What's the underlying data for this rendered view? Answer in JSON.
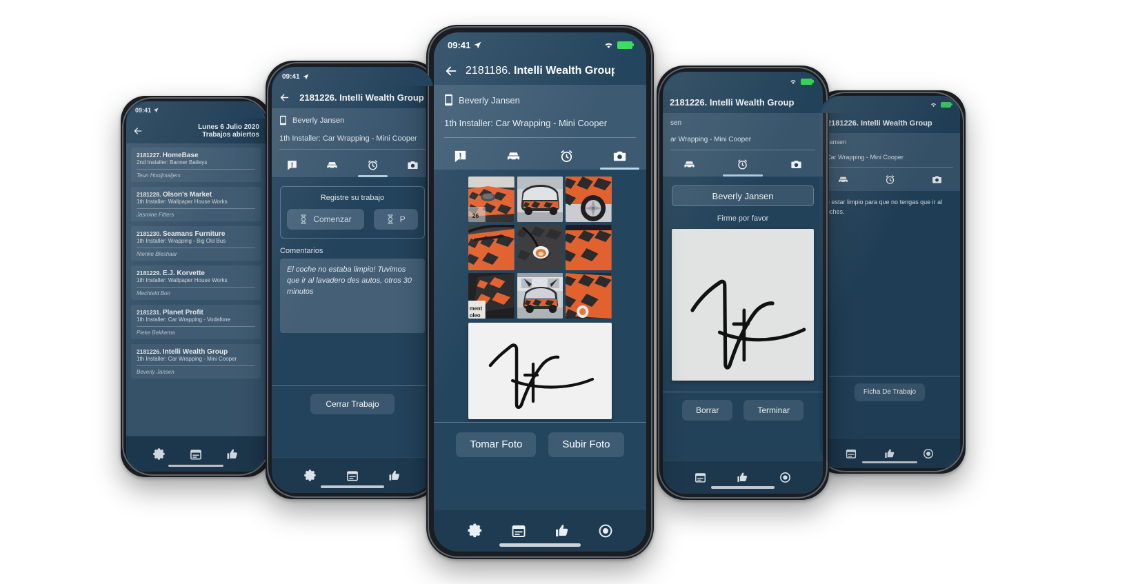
{
  "status_bar": {
    "time": "09:41",
    "location_icon": "location-arrow-icon",
    "wifi_icon": "wifi-icon",
    "battery_icon": "battery-icon"
  },
  "icons": {
    "back": "back-arrow-icon",
    "phone": "mobile-phone-icon",
    "gear": "gear-icon",
    "calendar": "calendar-icon",
    "thumbs_up": "thumbs-up-icon",
    "record": "record-circle-icon",
    "message_alert": "message-alert-icon",
    "car": "car-icon",
    "alarm": "alarm-clock-icon",
    "camera": "camera-icon",
    "hourglass": "hourglass-icon"
  },
  "colors": {
    "screen_bg": "#24455e",
    "panel_bg": "#3c5a72",
    "card_bg": "#48657c",
    "tabbar_bg": "#1f3b51",
    "accent_underline": "#b9d6ea",
    "battery_green": "#3ddc5f",
    "signature_pad": "#f1f1f1",
    "wrap_orange": "#e2622f",
    "wrap_dark": "#2b2b2d"
  },
  "phone1": {
    "header": {
      "line1": "Lunes 6 Julio 2020",
      "line2": "Trabajos abiertos"
    },
    "jobs": [
      {
        "id": "2181227.",
        "name": "HomeBase",
        "installer": "2nd Installer: Banner Batleys",
        "contact": "Teun Hooijmaijers"
      },
      {
        "id": "2181228.",
        "name": "Olson's Market",
        "installer": "1th Installer: Wallpaper House Works",
        "contact": "Jasmine Fitters"
      },
      {
        "id": "2181230.",
        "name": "Seamans Furniture",
        "installer": "1th Installer: Wrapping - Big Old Bus",
        "contact": "Nienke Bleshaar"
      },
      {
        "id": "2181229.",
        "name": "E.J. Korvette",
        "installer": "1th Installer: Wallpaper House Works",
        "contact": "Mechteld Bon"
      },
      {
        "id": "2181231.",
        "name": "Planet Profit",
        "installer": "1th Installer: Car Wrapping - Vodafone",
        "contact": "Pieke Bekkema"
      },
      {
        "id": "2181226.",
        "name": "Intelli Wealth Group",
        "installer": "1th Installer: Car Wrapping - Mini Cooper",
        "contact": "Beverly Jansen"
      }
    ],
    "tabbar": [
      "gear-icon",
      "calendar-icon",
      "thumbs-up-icon"
    ]
  },
  "phone2": {
    "title_num": "2181226.",
    "title_name": "Intelli Wealth Group",
    "contact": "Beverly Jansen",
    "installer": "1th Installer: Car Wrapping - Mini Cooper",
    "tabs": [
      "message-alert-icon",
      "car-icon",
      "alarm-clock-icon",
      "camera-icon"
    ],
    "active_tab_index": 2,
    "timer_caption": "Registre su trabajo",
    "btn_start": "Comenzar",
    "btn_second": "P",
    "comments_label": "Comentarios",
    "comment_text": "El coche no estaba limpio! Tuvimos que ir al lavadero des autos, otros 30 minutos",
    "btn_close_job": "Cerrar Trabajo",
    "tabbar": [
      "gear-icon",
      "calendar-icon",
      "thumbs-up-icon"
    ]
  },
  "phone3": {
    "title_num": "2181186.",
    "title_name": "Intelli Wealth Group",
    "contact": "Beverly Jansen",
    "installer": "1th Installer: Car Wrapping - Mini Cooper",
    "tabs": [
      "message-alert-icon",
      "car-icon",
      "alarm-clock-icon",
      "camera-icon"
    ],
    "active_tab_index": 3,
    "photo_count": 9,
    "btn_take_photo": "Tomar Foto",
    "btn_upload_photo": "Subir Foto",
    "tabbar": [
      "gear-icon",
      "calendar-icon",
      "thumbs-up-icon",
      "record-circle-icon"
    ]
  },
  "phone4": {
    "title_num": "2181226.",
    "title_name": "Intelli Wealth Group",
    "contact_partial": "sen",
    "installer_partial": "ar Wrapping - Mini Cooper",
    "tabs": [
      "car-icon",
      "alarm-clock-icon",
      "camera-icon"
    ],
    "active_tab_index": 1,
    "name_field_value": "Beverly Jansen",
    "sign_label": "Firme por favor",
    "btn_clear": "Borrar",
    "btn_finish": "Terminar",
    "tabbar": [
      "calendar-icon",
      "thumbs-up-icon",
      "record-circle-icon"
    ]
  },
  "phone5": {
    "title_num": "2181226.",
    "title_name": "Intelli Wealth Group",
    "contact_partial": "Jansen",
    "installer_partial": "Car Wrapping - Mini Cooper",
    "tabs": [
      "car-icon",
      "alarm-clock-icon",
      "camera-icon"
    ],
    "active_tab_index": 1,
    "note_text": "e estar limpio para que no tengas que ir al\noches.",
    "btn_worksheet": "Ficha De Trabajo",
    "tabbar": [
      "calendar-icon",
      "thumbs-up-icon",
      "record-circle-icon"
    ]
  }
}
